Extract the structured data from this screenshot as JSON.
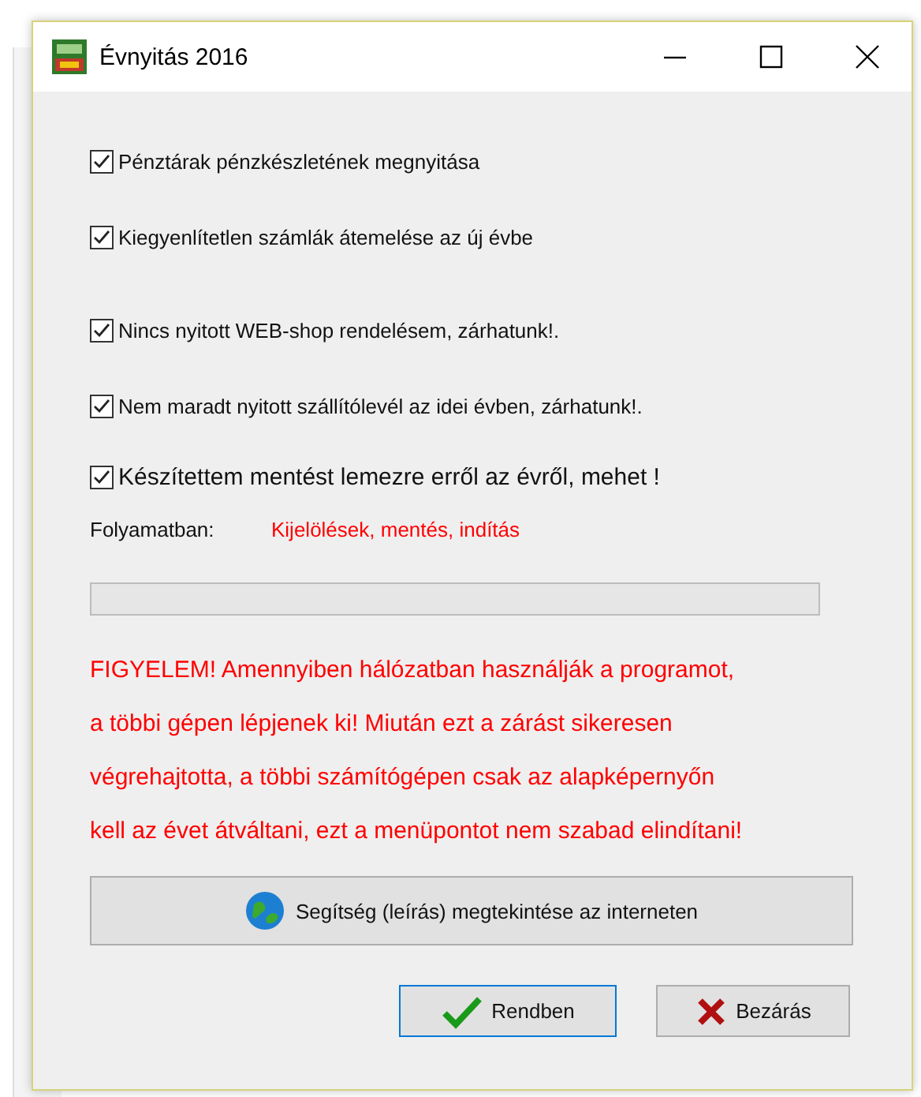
{
  "window": {
    "title": "Évnyitás 2016"
  },
  "checkboxes": [
    {
      "label": "Pénztárak pénzkészletének megnyitása",
      "checked": true
    },
    {
      "label": "Kiegyenlítetlen számlák átemelése az új évbe",
      "checked": true
    },
    {
      "label": "Nincs nyitott WEB-shop rendelésem, zárhatunk!.",
      "checked": true
    },
    {
      "label": "Nem maradt nyitott szállítólevél az idei évben, zárhatunk!.",
      "checked": true
    },
    {
      "label": "Készítettem mentést lemezre erről az évről, mehet !",
      "checked": true
    }
  ],
  "progress": {
    "label": "Folyamatban:",
    "status": "Kijelölések, mentés, indítás",
    "level": 0
  },
  "warning": [
    "FIGYELEM! Amennyiben hálózatban használják a programot,",
    "a többi gépen lépjenek ki! Miután ezt a zárást sikeresen",
    "végrehajtotta, a többi számítógépen csak az alapképernyőn",
    "kell az évet átváltani, ezt a menüpontot nem szabad elindítani!"
  ],
  "help_button": {
    "label": "Segítség (leírás) megtekintése az interneten"
  },
  "buttons": [
    {
      "label": "Rendben",
      "kind": "ok",
      "selected": true
    },
    {
      "label": "Bezárás",
      "kind": "close",
      "selected": false
    }
  ]
}
